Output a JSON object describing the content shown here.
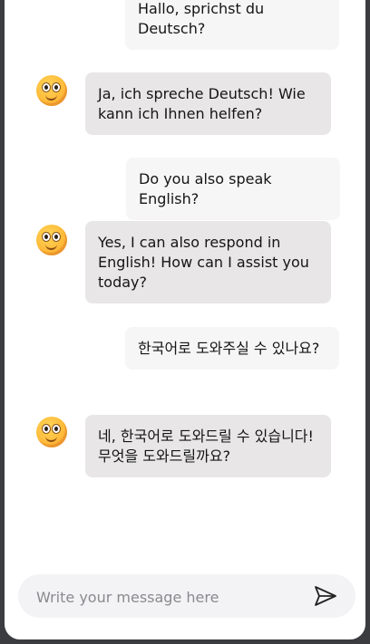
{
  "chat": {
    "messages": [
      {
        "role": "user",
        "text": "Hallo, sprichst du Deutsch?"
      },
      {
        "role": "assistant",
        "avatar": "smiley-face-icon",
        "text": "Ja, ich spreche Deutsch! Wie kann ich Ihnen helfen?"
      },
      {
        "role": "user",
        "text": "Do you also speak English?"
      },
      {
        "role": "assistant",
        "avatar": "smiley-face-icon",
        "text": "Yes, I can also respond in English! How can I assist you today?"
      },
      {
        "role": "user",
        "text": "한국어로 도와주실 수 있나요?"
      },
      {
        "role": "assistant",
        "avatar": "smiley-face-icon",
        "text": "네, 한국어로 도와드릴 수 있습니다! 무엇을 도와드릴까요?"
      }
    ]
  },
  "composer": {
    "placeholder": "Write your message here",
    "value": "",
    "send_icon": "paper-plane-icon"
  },
  "colors": {
    "frame": "#3a3c40",
    "user_bubble": "#f6f6f7",
    "assistant_bubble": "#e8e6e7",
    "input_bg": "#f3f3f5"
  }
}
